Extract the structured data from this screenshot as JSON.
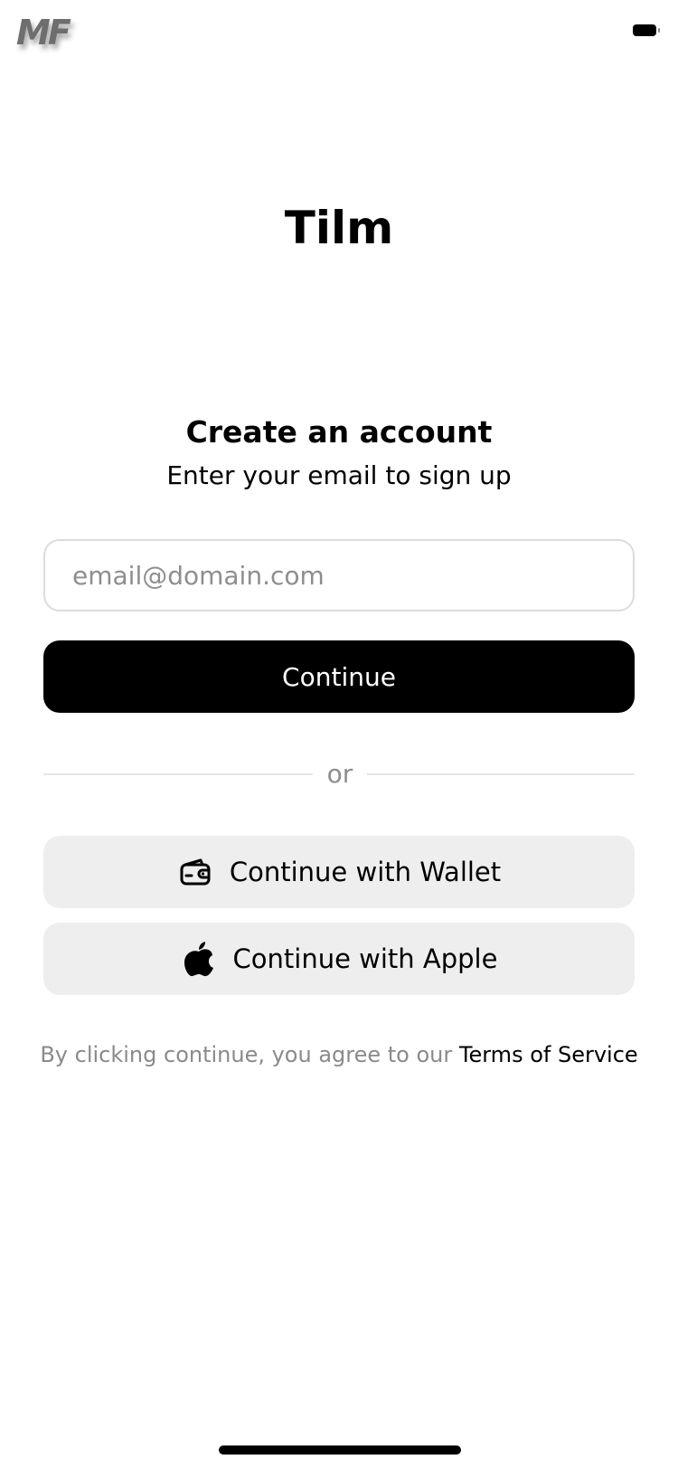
{
  "status_bar": {
    "logo_text": "MF",
    "battery_icon": "battery-full-icon"
  },
  "app": {
    "title": "Tilm"
  },
  "signup": {
    "heading": "Create an account",
    "subheading": "Enter your email to sign up",
    "email_placeholder": "email@domain.com",
    "email_value": "",
    "continue_label": "Continue",
    "divider_text": "or",
    "wallet_label": "Continue with Wallet",
    "wallet_icon": "wallet-icon",
    "apple_label": "Continue with Apple",
    "apple_icon": "apple-icon",
    "terms_prefix": "By clicking continue, you agree to our ",
    "terms_link": "Terms of Service"
  },
  "colors": {
    "primary": "#000000",
    "secondary_button_bg": "#eeeeee",
    "muted_text": "#8e8e8e",
    "input_border": "#dcdcdc"
  }
}
